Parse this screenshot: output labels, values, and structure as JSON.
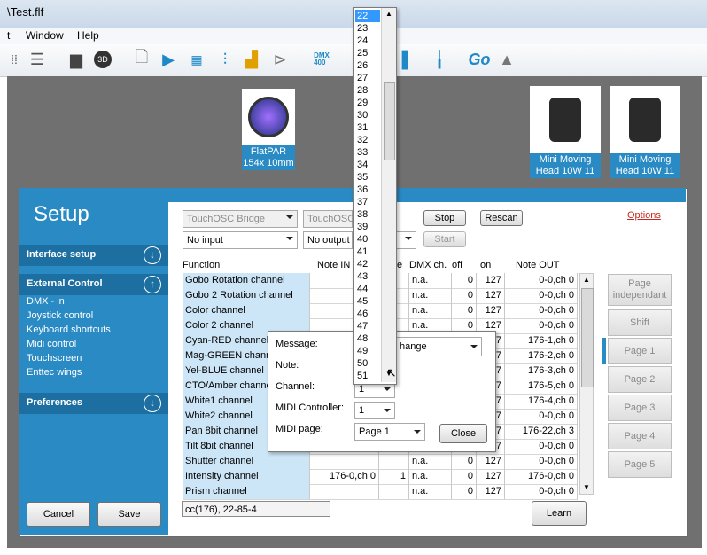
{
  "window": {
    "title": "\\Test.flf"
  },
  "menu": [
    "t",
    "Window",
    "Help"
  ],
  "toolbar": {
    "dmx_icon_label": "DMX\n400",
    "go_label": "Go",
    "3d_label": "3D"
  },
  "fixtures": [
    {
      "label": "FlatPAR\n154x 10mm"
    },
    {
      "label": "Mini Moving\nHead 10W 11"
    },
    {
      "label": "Mini Moving\nHead 10W 11"
    }
  ],
  "sidebar": {
    "title": "Setup",
    "interface_setup": "Interface setup",
    "external_control": "External Control",
    "items": [
      "DMX - in",
      "Joystick control",
      "Keyboard shortcuts",
      "Midi control",
      "Touchscreen",
      "Enttec wings"
    ],
    "preferences": "Preferences",
    "cancel": "Cancel",
    "save": "Save"
  },
  "controls": {
    "combo1": "TouchOSC Bridge",
    "combo2": "TouchOSC",
    "input": "No input",
    "output": "No output",
    "stop": "Stop",
    "start": "Start",
    "rescan": "Rescan",
    "options": "Options"
  },
  "table": {
    "headers": {
      "function": "Function",
      "note_in": "Note IN",
      "e": "e",
      "dmx_ch": "DMX ch.",
      "off": "off",
      "on": "on",
      "note_out": "Note OUT"
    },
    "rows": [
      {
        "function": "Gobo Rotation channel",
        "note_in": "",
        "dmx": "n.a.",
        "off": "0",
        "on": "127",
        "out": "0-0,ch 0"
      },
      {
        "function": "Gobo 2 Rotation channel",
        "note_in": "",
        "dmx": "n.a.",
        "off": "0",
        "on": "127",
        "out": "0-0,ch 0"
      },
      {
        "function": "Color channel",
        "note_in": "",
        "dmx": "n.a.",
        "off": "0",
        "on": "127",
        "out": "0-0,ch 0"
      },
      {
        "function": "Color 2 channel",
        "note_in": "",
        "dmx": "n.a.",
        "off": "0",
        "on": "127",
        "out": "0-0,ch 0"
      },
      {
        "function": "Cyan-RED channel",
        "note_in": "",
        "dmx": "",
        "off": "",
        "on": "7",
        "out": "176-1,ch 0"
      },
      {
        "function": "Mag-GREEN channel",
        "note_in": "",
        "dmx": "",
        "off": "",
        "on": "7",
        "out": "176-2,ch 0"
      },
      {
        "function": "Yel-BLUE channel",
        "note_in": "",
        "dmx": "",
        "off": "",
        "on": "7",
        "out": "176-3,ch 0"
      },
      {
        "function": "CTO/Amber channel",
        "note_in": "",
        "dmx": "",
        "off": "",
        "on": "7",
        "out": "176-5,ch 0"
      },
      {
        "function": "White1 channel",
        "note_in": "",
        "dmx": "",
        "off": "",
        "on": "7",
        "out": "176-4,ch 0"
      },
      {
        "function": "White2 channel",
        "note_in": "",
        "dmx": "",
        "off": "",
        "on": "7",
        "out": "0-0,ch 0"
      },
      {
        "function": "Pan 8bit channel",
        "note_in": "",
        "dmx": "",
        "off": "",
        "on": "7",
        "out": "176-22,ch 3"
      },
      {
        "function": "Tilt 8bit channel",
        "note_in": "",
        "dmx": "",
        "off": "",
        "on": "7",
        "out": "0-0,ch 0"
      },
      {
        "function": "Shutter channel",
        "note_in": "",
        "dmx": "n.a.",
        "off": "0",
        "on": "127",
        "out": "0-0,ch 0"
      },
      {
        "function": "Intensity channel",
        "note_in": "176-0,ch 0",
        "e_val": "1",
        "dmx": "n.a.",
        "off": "0",
        "on": "127",
        "out": "176-0,ch 0"
      },
      {
        "function": "Prism channel",
        "note_in": "",
        "dmx": "n.a.",
        "off": "0",
        "on": "127",
        "out": "0-0,ch 0"
      }
    ],
    "status": "cc(176), 22-85-4",
    "learn": "Learn"
  },
  "pages": [
    "Page\nindependant",
    "Shift",
    "Page 1",
    "Page 2",
    "Page 3",
    "Page 4",
    "Page 5"
  ],
  "popup": {
    "message_label": "Message:",
    "message_value": "hange",
    "note_label": "Note:",
    "channel_label": "Channel:",
    "channel_value": "1",
    "controller_label": "MIDI Controller:",
    "controller_value": "1",
    "page_label": "MIDI page:",
    "page_value": "Page 1",
    "close": "Close"
  },
  "dropdown_items": [
    "22",
    "23",
    "24",
    "25",
    "26",
    "27",
    "28",
    "29",
    "30",
    "31",
    "32",
    "33",
    "34",
    "35",
    "36",
    "37",
    "38",
    "39",
    "40",
    "41",
    "42",
    "43",
    "44",
    "45",
    "46",
    "47",
    "48",
    "49",
    "50",
    "51"
  ],
  "colors": {
    "accent": "#2a8ac4",
    "selected": "#3399ff"
  }
}
